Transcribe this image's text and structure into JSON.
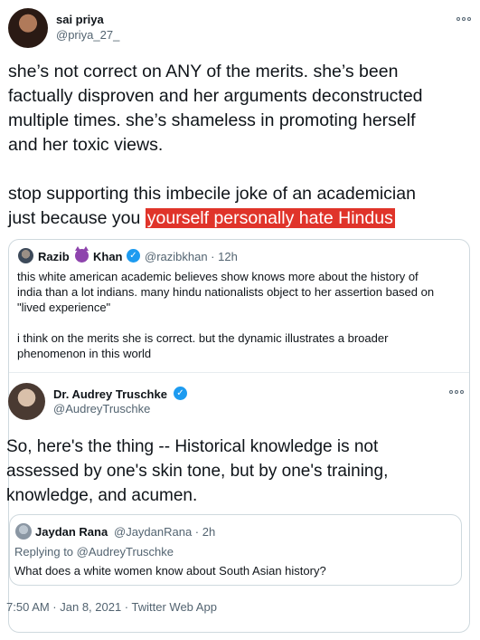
{
  "tweet": {
    "author_name": "sai priya",
    "author_handle": "@priya_27_",
    "lines": [
      "she’s not correct on ANY of the merits. she’s been",
      "factually disproven and her arguments deconstructed",
      "multiple times. she’s shameless in promoting herself",
      "and her toxic views.",
      "",
      "stop supporting this imbecile joke of an academician"
    ],
    "last_line_plain": "just because you ",
    "last_line_highlight": "yourself personally hate Hindus",
    "highlight_color": "#e0342a"
  },
  "quote": {
    "author_name": "Razib",
    "author_emoji": "devil-icon",
    "author_name_suffix": "Khan",
    "verified_mark": "✓",
    "author_handle_time": "@razibkhan · 12h",
    "lines": [
      "this white american academic believes show knows more about the history of",
      "india than a lot indians. many hindu nationalists object to her assertion based on",
      "\"lived experience\"",
      "",
      "i think on the merits she is correct. but the dynamic illustrates a broader",
      "phenomenon in this world"
    ]
  },
  "embedded": {
    "author_name": "Dr. Audrey Truschke",
    "verified_mark": "✓",
    "author_handle": "@AudreyTruschke",
    "lines": [
      "So, here's the thing -- Historical knowledge is not",
      "assessed by one's skin tone, but by one's training,",
      "knowledge, and acumen."
    ],
    "reply": {
      "author_name": "Jaydan Rana",
      "author_handle_time": "@JaydanRana · 2h",
      "replying_to": "Replying to @AudreyTruschke",
      "text": "What does a white women know about South Asian history?"
    },
    "meta": "7:50 AM · Jan 8, 2021 · Twitter Web App"
  },
  "colors": {
    "verified": "#1d9bf0",
    "secondary_text": "#536471",
    "border": "#cfd9de"
  }
}
